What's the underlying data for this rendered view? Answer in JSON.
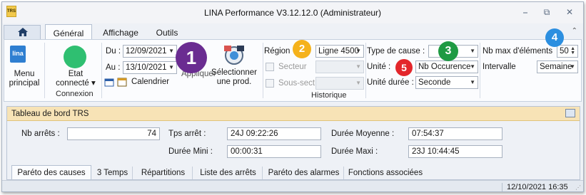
{
  "window": {
    "title": "LINA Performance  V3.12.12.0  (Administrateur)",
    "app_icon_text": "TRS",
    "minimize": "⎯",
    "restore": "⧉",
    "close": "✕"
  },
  "tabs": [
    {
      "label": "Général"
    },
    {
      "label": "Affichage"
    },
    {
      "label": "Outils"
    }
  ],
  "ribbon": {
    "lina_logo": "lina",
    "menu_label_1": "Menu",
    "menu_label_2": "principal",
    "status_label_1": "Etat",
    "status_label_2": "connecté",
    "status_dd": "▾",
    "status_color": "#2fbf71",
    "connexion_label": "Connexion",
    "du_label": "Du :",
    "du_value": "12/09/2021",
    "au_label": "Au :",
    "au_value": "13/10/2021",
    "calendar_label": "Calendrier",
    "apply_label": "Appliquer",
    "select_prod_1": "Sélectionner",
    "select_prod_2": "une prod.",
    "region_label": "Région",
    "region_value": "Ligne 4500",
    "secteur_label": "Secteur",
    "soussect_label": "Sous-sect",
    "historique_label": "Historique",
    "type_cause_label": "Type de cause :",
    "type_cause_value": "",
    "unite_label": "Unité :",
    "unite_value": "Nb Occurence",
    "unite_duree_label": "Unité durée :",
    "unite_duree_value": "Seconde",
    "nbmax_label": "Nb max d'éléments",
    "nbmax_value": "50",
    "intervalle_label": "Intervalle",
    "intervalle_value": "Semaine"
  },
  "badges": [
    {
      "number": "1",
      "color": "#6a2c91"
    },
    {
      "number": "2",
      "color": "#f5b21b"
    },
    {
      "number": "3",
      "color": "#1f9a43"
    },
    {
      "number": "4",
      "color": "#2c8fe0"
    },
    {
      "number": "5",
      "color": "#e3262b"
    }
  ],
  "dashboard": {
    "title": "Tableau de bord TRS",
    "nb_arrets_label": "Nb arrêts :",
    "nb_arrets_value": "74",
    "tps_arret_label": "Tps arrêt :",
    "tps_arret_value": "24J 09:22:26",
    "duree_moyenne_label": "Durée Moyenne :",
    "duree_moyenne_value": "07:54:37",
    "duree_mini_label": "Durée Mini :",
    "duree_mini_value": "00:00:31",
    "duree_maxi_label": "Durée Maxi :",
    "duree_maxi_value": "23J 10:44:45",
    "bottom_tabs": [
      {
        "label": "Paréto des causes"
      },
      {
        "label": "3 Temps"
      },
      {
        "label": "Répartitions"
      },
      {
        "label": "Liste des arrêts"
      },
      {
        "label": "Paréto des alarmes"
      },
      {
        "label": "Fonctions associées"
      }
    ]
  },
  "status_bar": {
    "datetime": "12/10/2021 16:35"
  }
}
